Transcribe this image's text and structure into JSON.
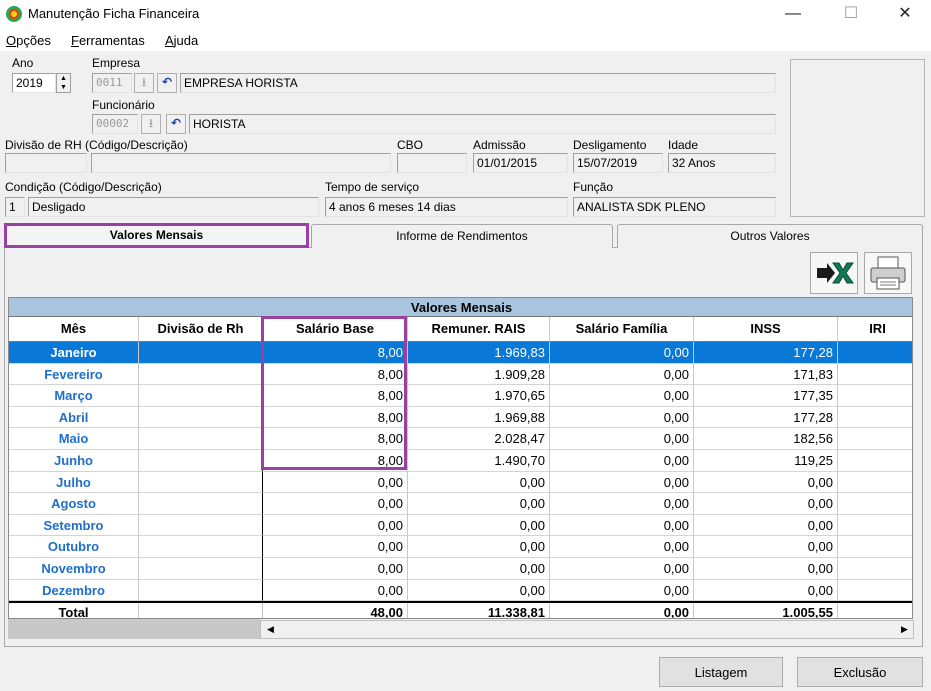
{
  "window": {
    "title": "Manutenção Ficha Financeira",
    "minimize": "—",
    "maximize": "☐",
    "close": "✕"
  },
  "menu": [
    {
      "hot": "O",
      "rest": "pções"
    },
    {
      "hot": "F",
      "rest": "erramentas"
    },
    {
      "hot": "A",
      "rest": "juda"
    }
  ],
  "form": {
    "ano_label": "Ano",
    "ano_value": "2019",
    "empresa_label": "Empresa",
    "empresa_code": "0011",
    "empresa_name": "EMPRESA HORISTA",
    "funcionario_label": "Funcionário",
    "funcionario_code": "00002",
    "funcionario_name": "HORISTA",
    "divisao_label": "Divisão de RH (Código/Descrição)",
    "divisao_code": "",
    "divisao_desc": "",
    "cbo_label": "CBO",
    "cbo_value": "",
    "admissao_label": "Admissão",
    "admissao_value": "01/01/2015",
    "desligamento_label": "Desligamento",
    "desligamento_value": "15/07/2019",
    "idade_label": "Idade",
    "idade_value": "32 Anos",
    "condicao_label": "Condição (Código/Descrição)",
    "condicao_code": "1",
    "condicao_desc": "Desligado",
    "tempo_label": "Tempo de serviço",
    "tempo_value": "4 anos 6 meses 14 dias",
    "funcao_label": "Função",
    "funcao_value": "ANALISTA SDK PLENO"
  },
  "tabs": [
    {
      "label": "Valores Mensais"
    },
    {
      "label": "Informe de Rendimentos"
    },
    {
      "label": "Outros Valores"
    }
  ],
  "grid": {
    "title": "Valores Mensais",
    "columns": [
      "Mês",
      "Divisão de Rh",
      "Salário Base",
      "Remuner. RAIS",
      "Salário Família",
      "INSS",
      "IRI"
    ],
    "rows": [
      {
        "mes": "Janeiro",
        "div": "",
        "sal": "8,00",
        "rais": "1.969,83",
        "fam": "0,00",
        "inss": "177,28"
      },
      {
        "mes": "Fevereiro",
        "div": "",
        "sal": "8,00",
        "rais": "1.909,28",
        "fam": "0,00",
        "inss": "171,83"
      },
      {
        "mes": "Março",
        "div": "",
        "sal": "8,00",
        "rais": "1.970,65",
        "fam": "0,00",
        "inss": "177,35"
      },
      {
        "mes": "Abril",
        "div": "",
        "sal": "8,00",
        "rais": "1.969,88",
        "fam": "0,00",
        "inss": "177,28"
      },
      {
        "mes": "Maio",
        "div": "",
        "sal": "8,00",
        "rais": "2.028,47",
        "fam": "0,00",
        "inss": "182,56"
      },
      {
        "mes": "Junho",
        "div": "",
        "sal": "8,00",
        "rais": "1.490,70",
        "fam": "0,00",
        "inss": "119,25"
      },
      {
        "mes": "Julho",
        "div": "",
        "sal": "0,00",
        "rais": "0,00",
        "fam": "0,00",
        "inss": "0,00"
      },
      {
        "mes": "Agosto",
        "div": "",
        "sal": "0,00",
        "rais": "0,00",
        "fam": "0,00",
        "inss": "0,00"
      },
      {
        "mes": "Setembro",
        "div": "",
        "sal": "0,00",
        "rais": "0,00",
        "fam": "0,00",
        "inss": "0,00"
      },
      {
        "mes": "Outubro",
        "div": "",
        "sal": "0,00",
        "rais": "0,00",
        "fam": "0,00",
        "inss": "0,00"
      },
      {
        "mes": "Novembro",
        "div": "",
        "sal": "0,00",
        "rais": "0,00",
        "fam": "0,00",
        "inss": "0,00"
      },
      {
        "mes": "Dezembro",
        "div": "",
        "sal": "0,00",
        "rais": "0,00",
        "fam": "0,00",
        "inss": "0,00"
      }
    ],
    "total": {
      "mes": "Total",
      "div": "",
      "sal": "48,00",
      "rais": "11.338,81",
      "fam": "0,00",
      "inss": "1.005,55"
    }
  },
  "buttons": {
    "listagem": "Listagem",
    "exclusao": "Exclusão"
  },
  "colors": {
    "selection": "#0a78d7",
    "month_text": "#1f6fc8",
    "highlight": "#9b3fa5",
    "grid_header": "#a8c4de"
  }
}
